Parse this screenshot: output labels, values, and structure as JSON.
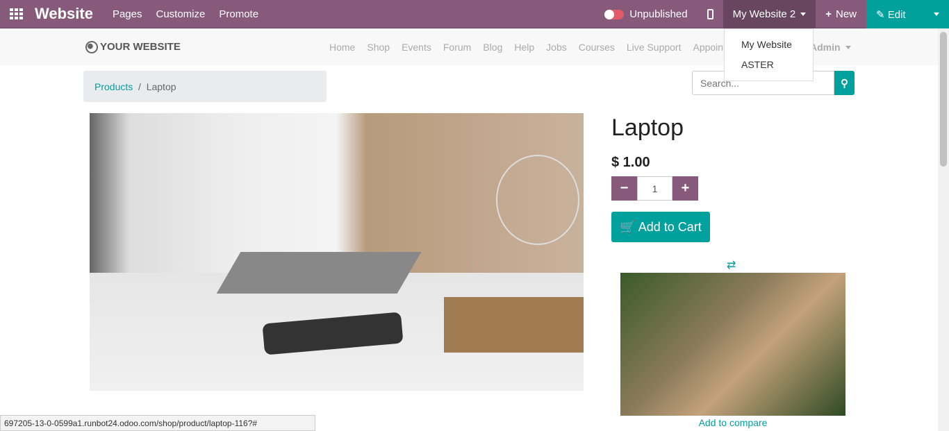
{
  "topbar": {
    "brand": "Website",
    "menus": [
      "Pages",
      "Customize",
      "Promote"
    ],
    "publish_status": "Unpublished",
    "website_selector": "My Website 2",
    "new_label": "New",
    "edit_label": "Edit",
    "accent": "#875a7b",
    "primary": "#00a09d"
  },
  "website_dropdown": [
    "My Website",
    "ASTER"
  ],
  "nav": {
    "logo": "YOUR WEBSITE",
    "links": [
      "Home",
      "Shop",
      "Events",
      "Forum",
      "Blog",
      "Help",
      "Jobs",
      "Courses",
      "Live Support",
      "Appointm"
    ],
    "user": "Admin"
  },
  "breadcrumb": {
    "parent": "Products",
    "separator": "/",
    "current": "Laptop"
  },
  "search": {
    "placeholder": "Search..."
  },
  "product": {
    "name": "Laptop",
    "price": "$ 1.00",
    "quantity": "1",
    "add_to_cart": "Add to Cart",
    "add_to_compare": "Add to compare"
  },
  "statusbar": "697205-13-0-0599a1.runbot24.odoo.com/shop/product/laptop-116?#"
}
